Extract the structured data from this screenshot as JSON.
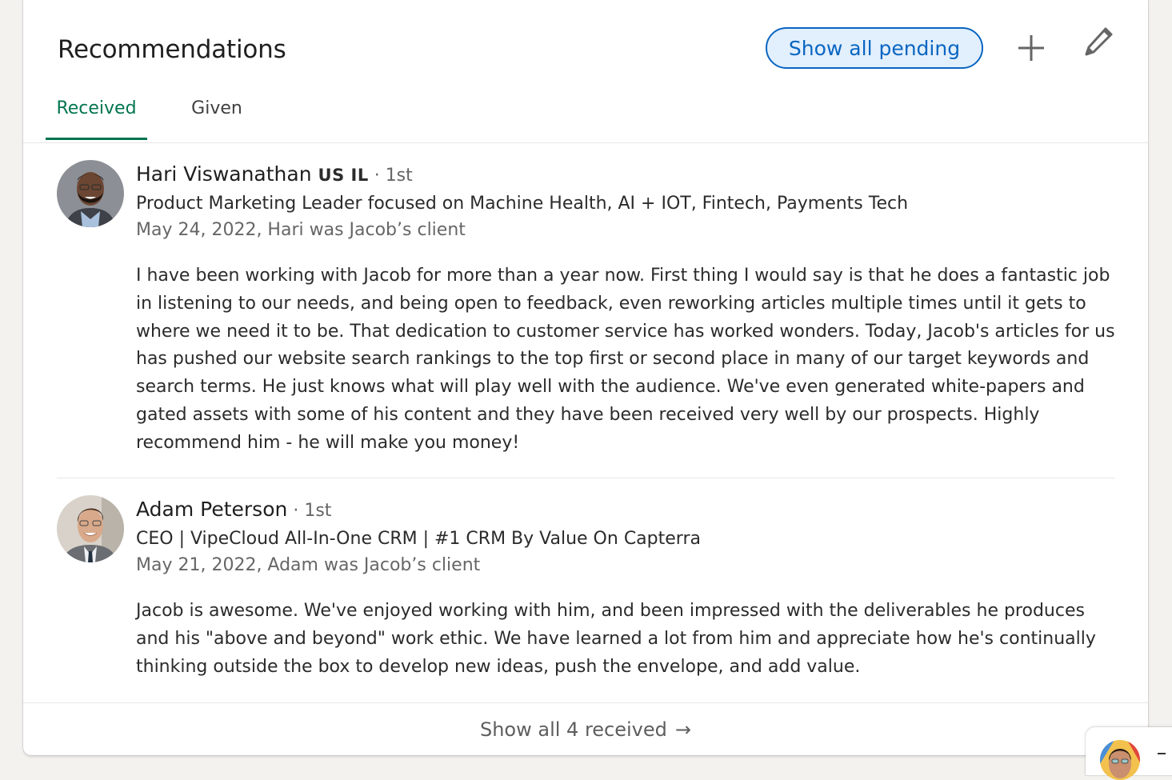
{
  "section": {
    "title": "Recommendations",
    "show_pending_label": "Show all pending",
    "add_icon": "plus-icon",
    "edit_icon": "pencil-icon"
  },
  "tabs": [
    {
      "label": "Received",
      "active": true
    },
    {
      "label": "Given",
      "active": false
    }
  ],
  "recommendations": [
    {
      "name": "Hari Viswanathan",
      "badge": "US IL",
      "separator": " · ",
      "degree": "1st",
      "headline": "Product Marketing Leader focused on Machine Health, AI + IOT, Fintech, Payments Tech",
      "meta": "May 24, 2022, Hari was Jacob’s client",
      "text": "I have been working with Jacob for more than a year now. First thing I would say is that he does a fantastic job in listening to our needs, and being open to feedback, even reworking articles multiple times until it gets to where we need it to be. That dedication to customer service has worked wonders. Today, Jacob's articles for us has pushed our website search rankings to the top first or second place in many of our target keywords and search terms. He just knows what will play well with the audience. We've even generated white-papers and gated assets with some of his content and they have been received very well by our prospects. Highly recommend him - he will make you money!"
    },
    {
      "name": "Adam Peterson",
      "badge": "",
      "separator": " · ",
      "degree": "1st",
      "headline": "CEO | VipeCloud All-In-One CRM | #1 CRM By Value On Capterra",
      "meta": "May 21, 2022, Adam was Jacob’s client",
      "text": "Jacob is awesome. We've enjoyed working with him, and been impressed with the deliverables he produces and his \"above and beyond\" work ethic. We have learned a lot from him and appreciate how he's continually thinking outside the box to develop new ideas, push the envelope, and add value."
    }
  ],
  "footer": {
    "show_all_label": "Show all 4 received",
    "arrow": "→"
  },
  "colors": {
    "accent_green": "#01754f",
    "link_blue": "#0a66c2",
    "pending_bg": "#e2effc"
  }
}
